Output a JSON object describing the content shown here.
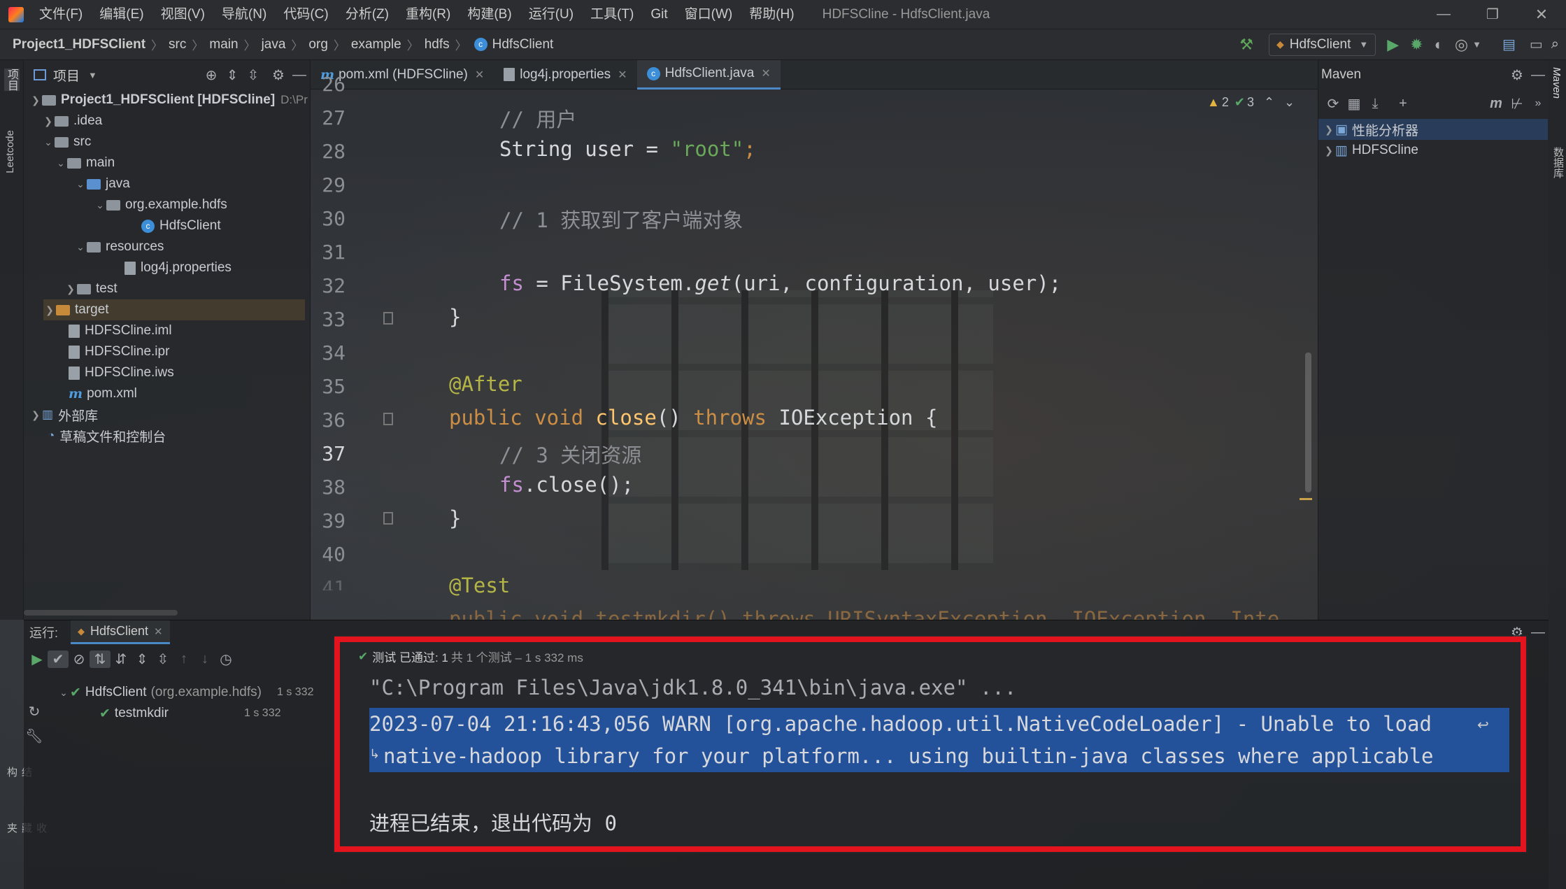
{
  "menubar": {
    "items": [
      "文件(F)",
      "编辑(E)",
      "视图(V)",
      "导航(N)",
      "代码(C)",
      "分析(Z)",
      "重构(R)",
      "构建(B)",
      "运行(U)",
      "工具(T)",
      "Git",
      "窗口(W)",
      "帮助(H)"
    ],
    "title": "HDFSCline - HdfsClient.java"
  },
  "breadcrumb": [
    "Project1_HDFSClient",
    "src",
    "main",
    "java",
    "org",
    "example",
    "hdfs",
    "HdfsClient"
  ],
  "toolbar": {
    "run_config": "HdfsClient"
  },
  "left_strip": {
    "project": "项目",
    "leetcode": "Leetcode",
    "structure": "结构",
    "favorites": "收藏夹"
  },
  "project_panel": {
    "title": "项目",
    "root": "Project1_HDFSClient [HDFSCline]",
    "root_path": "D:\\Pr",
    "items": [
      ".idea",
      "src",
      "main",
      "java",
      "org.example.hdfs",
      "HdfsClient",
      "resources",
      "log4j.properties",
      "test",
      "target",
      "HDFSCline.iml",
      "HDFSCline.ipr",
      "HDFSCline.iws",
      "pom.xml",
      "外部库",
      "草稿文件和控制台"
    ]
  },
  "editor": {
    "tabs": [
      "pom.xml (HDFSCline)",
      "log4j.properties",
      "HdfsClient.java"
    ],
    "inspections": {
      "warnings": "2",
      "ok": "3"
    },
    "line_numbers": [
      "26",
      "27",
      "28",
      "29",
      "30",
      "31",
      "32",
      "33",
      "34",
      "35",
      "36",
      "37",
      "38",
      "39",
      "40",
      "41"
    ],
    "code": {
      "l26": "// 用户",
      "l27_type": "String user = ",
      "l27_str": "\"root\"",
      "l27_end": ";",
      "l29": "// 1 获取到了客户端对象",
      "l31_fs": "fs",
      "l31_mid": " = FileSystem.",
      "l31_get": "get",
      "l31_args": "(uri, configuration, user);",
      "l32": "}",
      "l34": "@After",
      "l35_pub": "public void ",
      "l35_fn": "close",
      "l35_mid": "() ",
      "l35_throws": "throws",
      "l35_end": " IOException {",
      "l36": "// 3 关闭资源",
      "l37_fs": "fs",
      "l37_end": ".close();",
      "l38": "}",
      "l40": "@Test",
      "l41": "public void testmkdir() throws URISyntaxException, IOException, Inte"
    }
  },
  "maven": {
    "title": "Maven",
    "items": [
      "性能分析器",
      "HDFSCline"
    ],
    "strip_label": "Maven",
    "db_label": "数据库"
  },
  "run": {
    "label": "运行:",
    "tab": "HdfsClient",
    "status": "测试 已通过: 1",
    "status_detail": "共 1 个测试 – 1 s 332 ms",
    "tree": [
      {
        "name": "HdfsClient",
        "pkg": "(org.example.hdfs)",
        "time": "1 s 332 ms"
      },
      {
        "name": "testmkdir",
        "time": "1 s 332 ms"
      }
    ]
  },
  "console": {
    "lines": [
      "\"C:\\Program Files\\Java\\jdk1.8.0_341\\bin\\java.exe\" ...",
      "2023-07-04 21:16:43,056 WARN [org.apache.hadoop.util.NativeCodeLoader] - Unable to load",
      "native-hadoop library for your platform... using builtin-java classes where applicable",
      "进程已结束，退出代码为 0"
    ]
  },
  "colors": {
    "highlight_box": "#e3141d",
    "selection": "#23519a",
    "keyword": "#cc8e45",
    "string": "#6ba95a"
  }
}
